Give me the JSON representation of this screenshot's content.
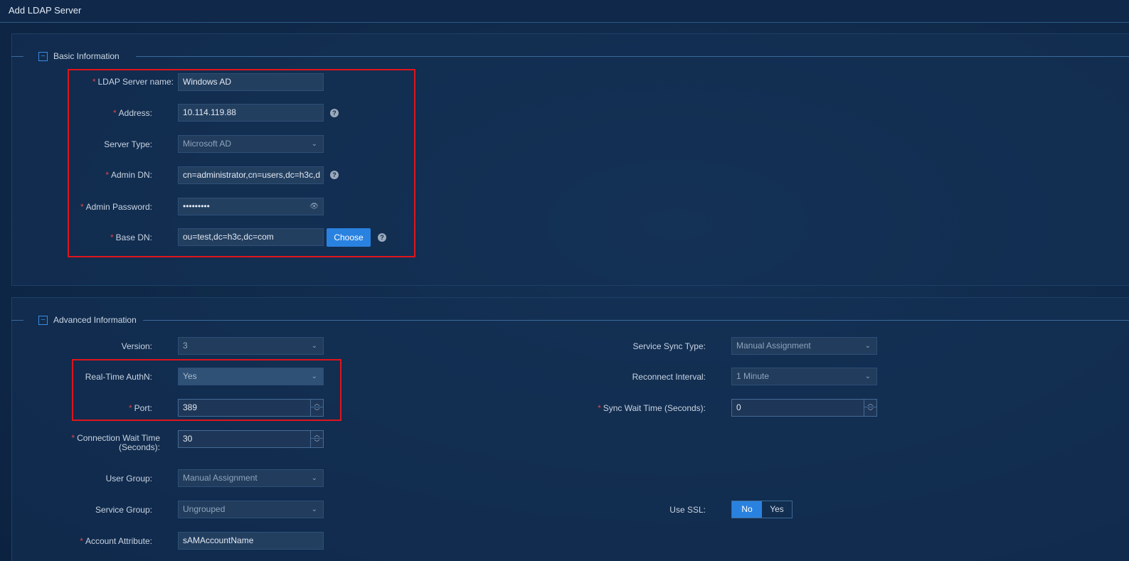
{
  "window": {
    "title": "Add LDAP Server"
  },
  "basic": {
    "section_title": "Basic Information",
    "collapse_icon": "minus-square-icon",
    "server_name": {
      "label": "LDAP Server name:",
      "value": "Windows AD"
    },
    "address": {
      "label": "Address:",
      "value": "10.114.119.88"
    },
    "server_type": {
      "label": "Server Type:",
      "value": "Microsoft AD"
    },
    "admin_dn": {
      "label": "Admin DN:",
      "value": "cn=administrator,cn=users,dc=h3c,d"
    },
    "admin_password": {
      "label": "Admin Password:",
      "value": "•••••••••"
    },
    "base_dn": {
      "label": "Base DN:",
      "value": "ou=test,dc=h3c,dc=com",
      "button": "Choose"
    }
  },
  "advanced": {
    "section_title": "Advanced Information",
    "version": {
      "label": "Version:",
      "value": "3"
    },
    "realtime_authn": {
      "label": "Real-Time AuthN:",
      "value": "Yes"
    },
    "port": {
      "label": "Port:",
      "value": "389"
    },
    "connection_wait": {
      "label": "Connection Wait Time (Seconds):",
      "value": "30"
    },
    "user_group": {
      "label": "User Group:",
      "value": "Manual Assignment"
    },
    "service_group": {
      "label": "Service Group:",
      "value": "Ungrouped"
    },
    "account_attribute": {
      "label": "Account Attribute:",
      "value": "sAMAccountName"
    },
    "service_sync_type": {
      "label": "Service Sync Type:",
      "value": "Manual Assignment"
    },
    "reconnect_interval": {
      "label": "Reconnect Interval:",
      "value": "1 Minute"
    },
    "sync_wait": {
      "label": "Sync Wait Time (Seconds):",
      "value": "0"
    },
    "use_ssl": {
      "label": "Use SSL:",
      "options": [
        "No",
        "Yes"
      ],
      "selected": "No"
    }
  },
  "colors": {
    "accent": "#2a82e0",
    "required": "#e0454a",
    "highlight_box": "#e0141c",
    "background": "#0f2848"
  }
}
